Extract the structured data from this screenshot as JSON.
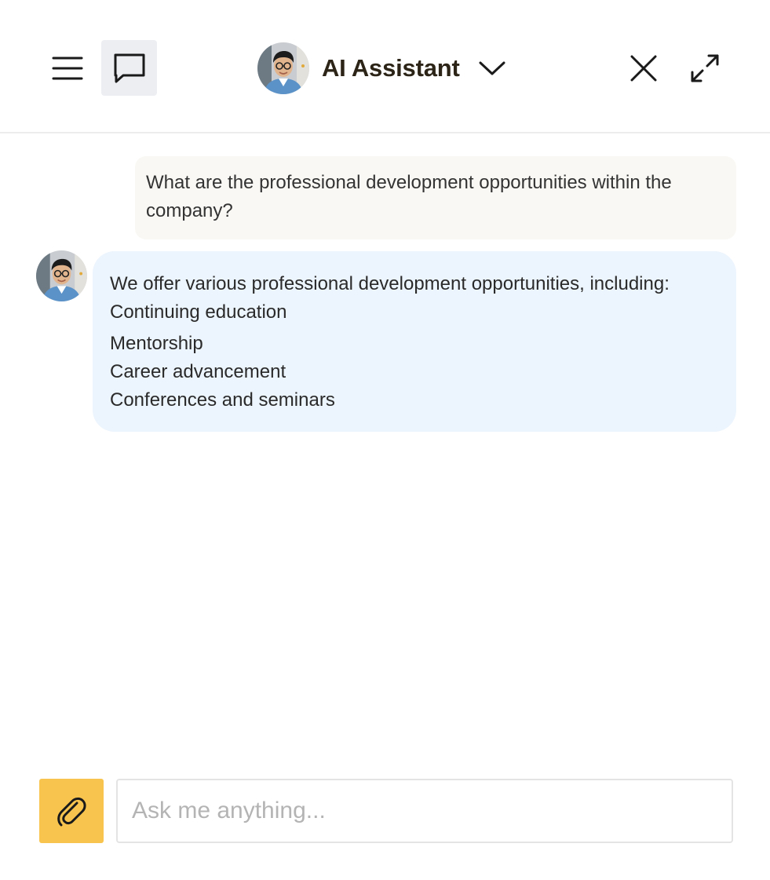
{
  "header": {
    "title": "AI Assistant",
    "icons": {
      "menu": "menu-icon",
      "chat": "chat-bubble-icon",
      "dropdown": "chevron-down-icon",
      "close": "close-icon",
      "expand": "expand-icon"
    }
  },
  "messages": {
    "user": {
      "text": "What are the professional development opportunities within the company?"
    },
    "assistant": {
      "intro": "We offer various professional development opportunities, including:",
      "items": [
        "Continuing education",
        "Mentorship",
        "Career advancement",
        "Conferences and seminars"
      ]
    }
  },
  "composer": {
    "placeholder": "Ask me anything...",
    "value": "",
    "attach_icon": "paperclip-icon"
  },
  "colors": {
    "attach_button": "#f8c44d",
    "assistant_bubble": "#ecf4fd",
    "user_bubble": "#f9f8f4",
    "active_icon_bg": "#eceef2",
    "title_text": "#2b2417"
  }
}
